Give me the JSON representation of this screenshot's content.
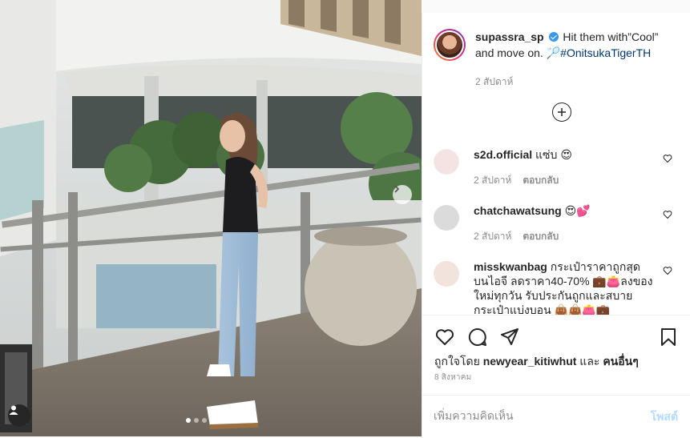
{
  "post": {
    "author": "supassra_sp",
    "caption_text": "Hit them with”Cool” and move on. 🏸",
    "hashtag": "#OnitsukaTigerTH",
    "time_ago": "2 สัปดาห์",
    "verified": true
  },
  "comments": [
    {
      "username": "s2d.official",
      "text": "แซ่บ 😍",
      "time": "2 สัปดาห์",
      "reply_label": "ตอบกลับ",
      "avatar_color": "#f3d6d6"
    },
    {
      "username": "chatchawatsung",
      "text": "😍💕",
      "time": "2 สัปดาห์",
      "reply_label": "ตอบกลับ",
      "avatar_color": "#dcdcdc"
    },
    {
      "username": "misskwanbag",
      "text": "กระเป๋าราคาถูกสุดบนไอจี ลดราคา40-70% 💼👛ลงของใหม่ทุกวัน รับประกันถูกและสบายกระเป๋าแบ่งบอน 👜👜👛💼",
      "time": "",
      "reply_label": "",
      "avatar_color": "#f2e4dc"
    }
  ],
  "actions": {
    "like_icon": "heart-outline-icon",
    "comment_icon": "speech-bubble-icon",
    "share_icon": "paper-plane-icon",
    "save_icon": "bookmark-icon"
  },
  "likes": {
    "prefix": "ถูกใจโดย",
    "user": "newyear_kitiwhut",
    "joiner": "และ",
    "others": "คนอื่นๆ"
  },
  "date": "8 สิงหาคม",
  "add_comment": {
    "placeholder": "เพิ่มความคิดเห็น",
    "post_label": "โพสต์"
  },
  "carousel": {
    "total": 3,
    "active": 1
  },
  "colors": {
    "accent": "#3897f0",
    "post_disabled": "#b3dbff",
    "muted": "#8e8e8e"
  }
}
